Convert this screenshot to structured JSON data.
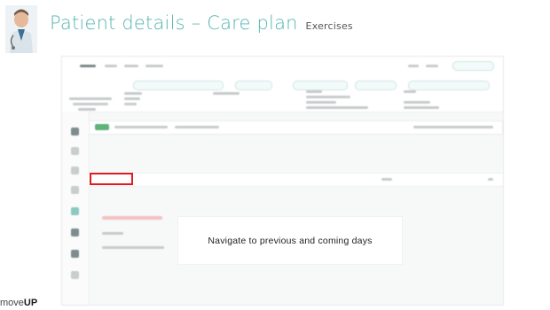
{
  "slide": {
    "title_main": "Patient details – Care plan",
    "title_sub": "Exercises",
    "brand_prefix": "move",
    "brand_suffix": "UP",
    "callout_text": "Navigate to previous and coming days"
  },
  "colors": {
    "title": "#55b6b0",
    "highlight": "#e11b22"
  },
  "icons": {
    "avatar": "doctor-avatar-icon"
  }
}
